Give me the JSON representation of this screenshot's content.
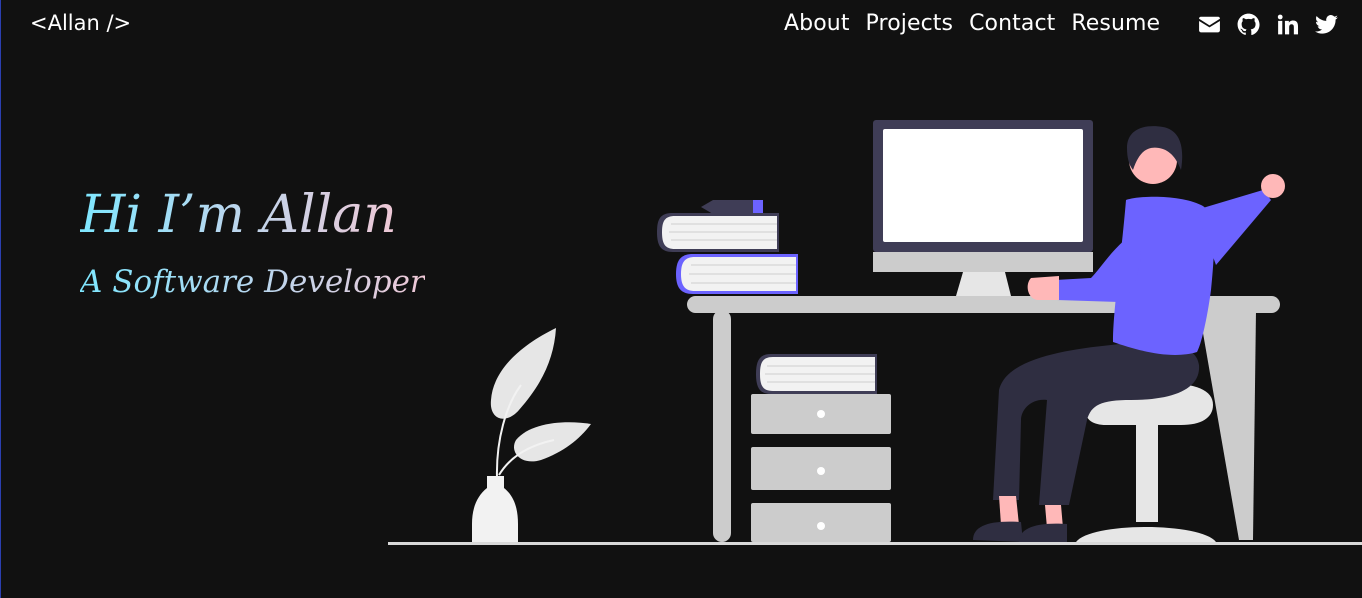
{
  "nav": {
    "brand": "<Allan />",
    "links": [
      {
        "label": "About"
      },
      {
        "label": "Projects"
      },
      {
        "label": "Contact"
      },
      {
        "label": "Resume"
      }
    ],
    "social": [
      {
        "icon": "envelope-icon"
      },
      {
        "icon": "github-icon"
      },
      {
        "icon": "linkedin-icon"
      },
      {
        "icon": "twitter-icon"
      }
    ]
  },
  "hero": {
    "title": "Hi I’m Allan",
    "subtitle": "A Software Developer"
  },
  "colors": {
    "background": "#111111",
    "accent": "#6c63ff",
    "gradient_start": "#7ee7ff",
    "gradient_end": "#efc8d6"
  }
}
